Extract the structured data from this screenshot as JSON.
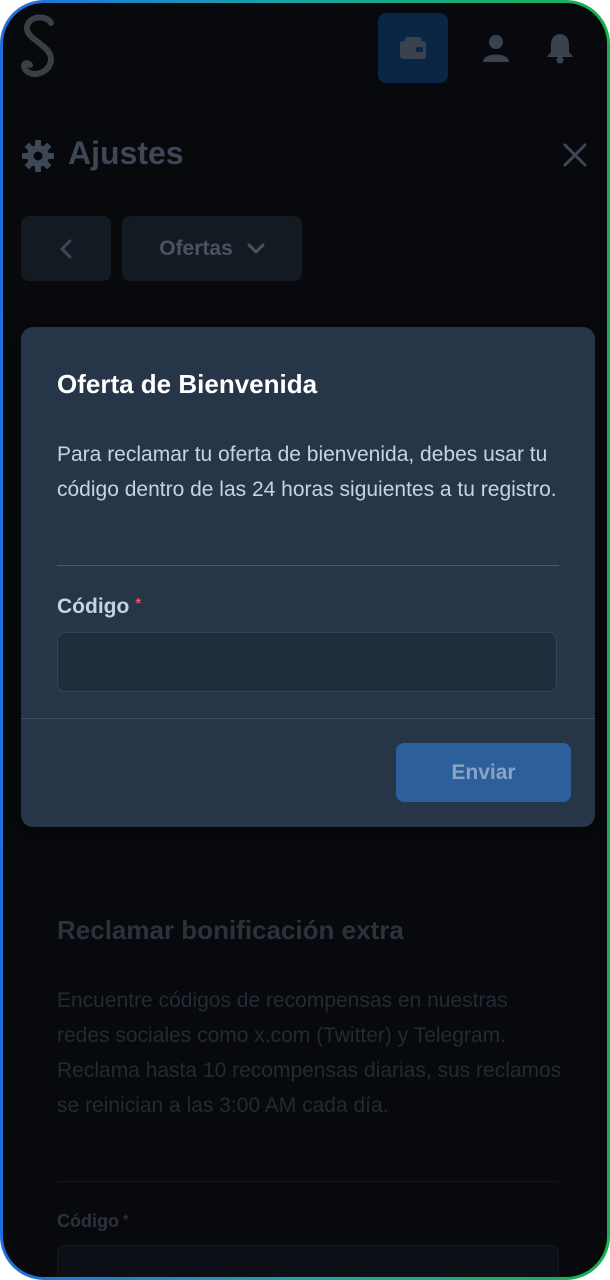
{
  "topbar": {
    "logo_icon": "script-s-logo",
    "wallet_icon": "wallet-icon",
    "user_icon": "user-icon",
    "bell_icon": "bell-icon"
  },
  "header": {
    "title": "Ajustes",
    "gear_icon": "gear-icon",
    "close_icon": "close-icon"
  },
  "nav": {
    "back_icon": "chevron-left-icon",
    "select_label": "Ofertas",
    "select_icon": "chevron-down-icon"
  },
  "modal": {
    "title": "Oferta de Bienvenida",
    "description": "Para reclamar tu oferta de bienvenida, debes usar tu código dentro de las 24 horas siguientes a tu registro.",
    "field_label": "Código",
    "required_mark": "*",
    "field_value": "",
    "submit_label": "Enviar"
  },
  "background_section": {
    "title": "Reclamar bonificación extra",
    "description": "Encuentre códigos de recompensas en nuestras redes sociales como x.com (Twitter) y Telegram. Reclama hasta 10 recompensas diarias, sus reclamos se reinician a las 3:00 AM cada día.",
    "field_label": "Código",
    "required_mark": "*"
  },
  "colors": {
    "accent": "#2c5f9c",
    "modal_bg": "#263547",
    "page_bg": "#07090d",
    "required": "#ef4f6a"
  }
}
